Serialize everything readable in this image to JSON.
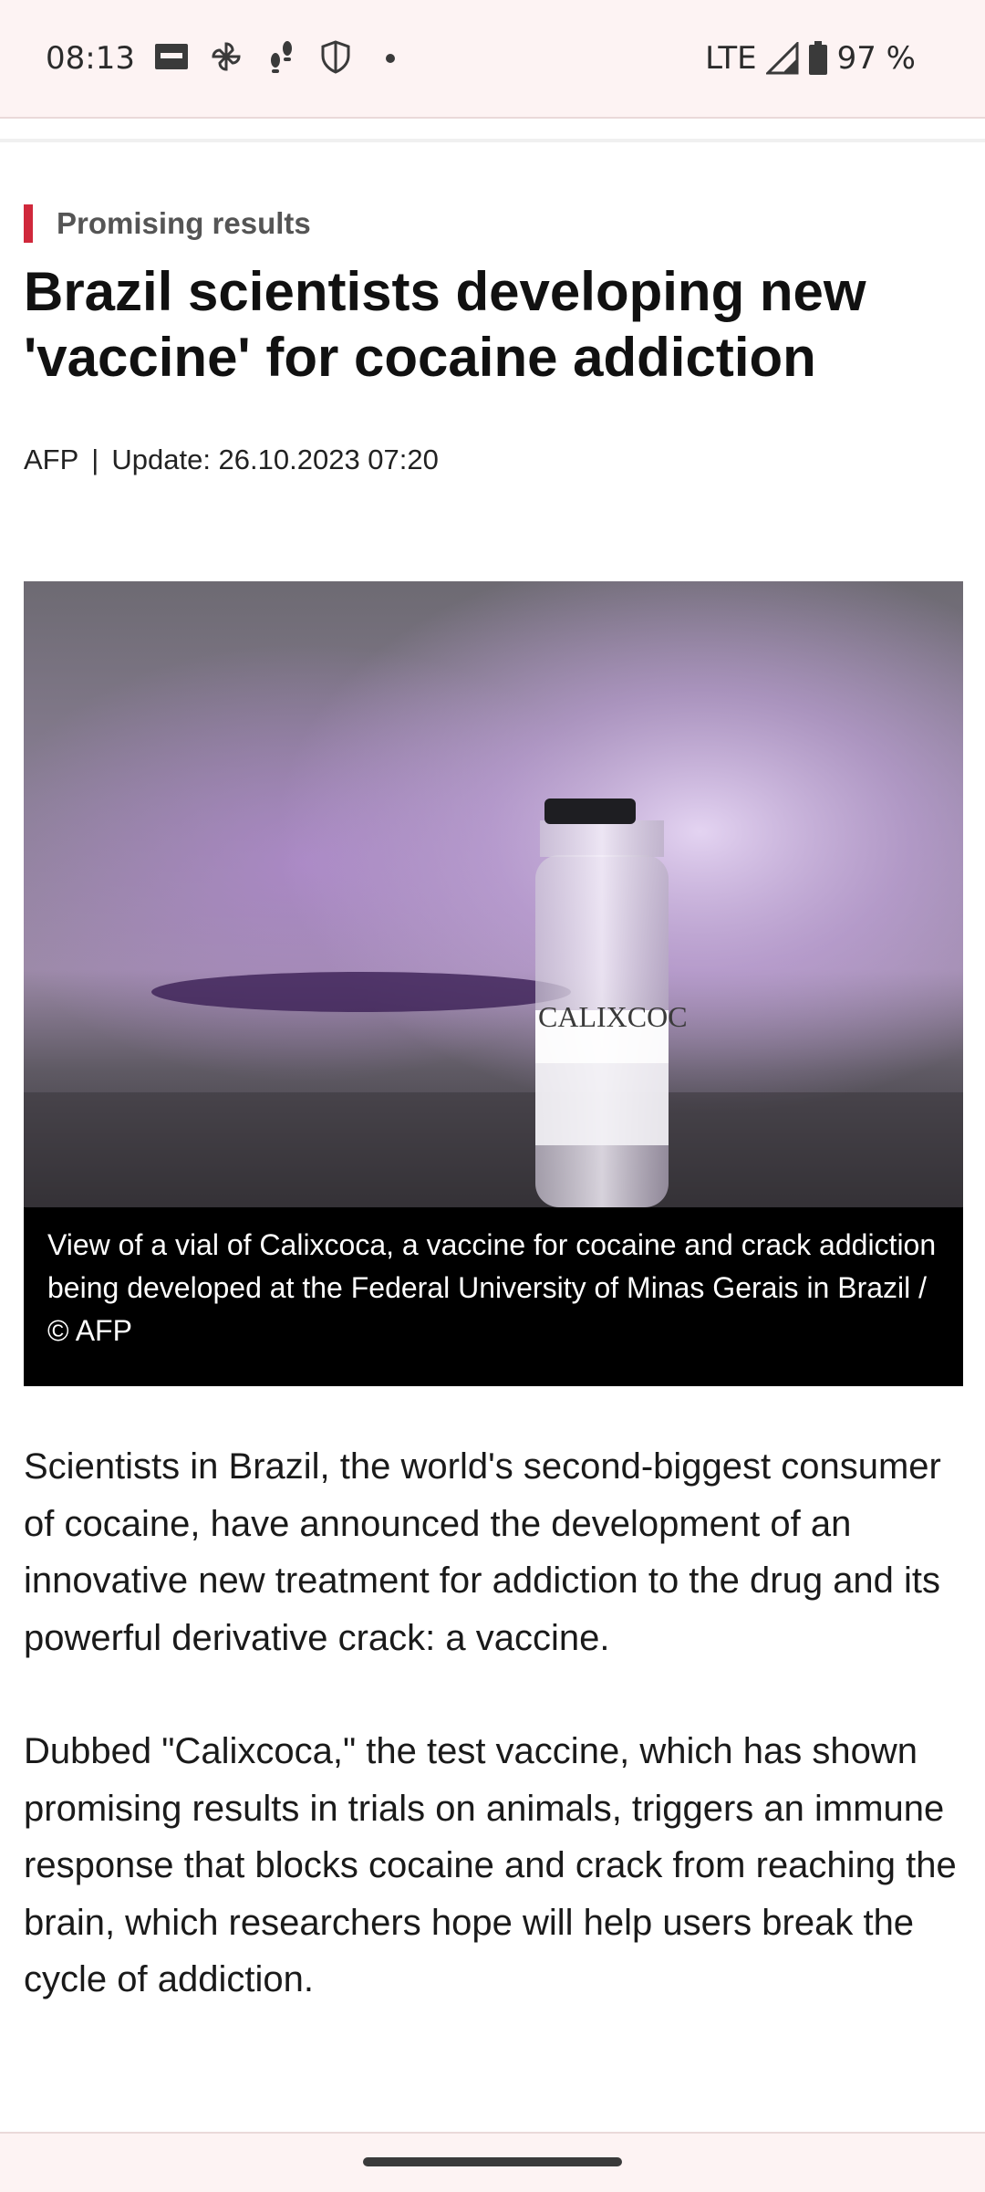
{
  "status_bar": {
    "time": "08:13",
    "icons": [
      "news-app-icon",
      "pinwheel-icon",
      "footsteps-icon",
      "shield-icon",
      "dot-icon"
    ],
    "network": "LTE",
    "battery": "97 %"
  },
  "article": {
    "kicker": "Promising results",
    "headline": "Brazil scientists developing new 'vaccine' for cocaine addiction",
    "source": "AFP",
    "separator": "|",
    "updated": "Update: 26.10.2023 07:20",
    "image": {
      "vial_label": "CALIXCOC",
      "caption": "View of a vial of Calixcoca, a vaccine for cocaine and crack addiction being developed at the Federal University of Minas Gerais in Brazil / © AFP"
    },
    "paragraphs": [
      "Scientists in Brazil, the world's second-biggest consumer of cocaine, have announced the development of an innovative new treatment for addiction to the drug and its powerful derivative crack: a vaccine.",
      "Dubbed \"Calixcoca,\" the test vaccine, which has shown promising results in trials on animals, triggers an immune response that blocks cocaine and crack from reaching the brain, which researchers hope will help users break the cycle of addiction."
    ]
  },
  "colors": {
    "accent": "#d0283b",
    "system_bar": "#fdf3f3",
    "caption_bg": "#000000"
  }
}
